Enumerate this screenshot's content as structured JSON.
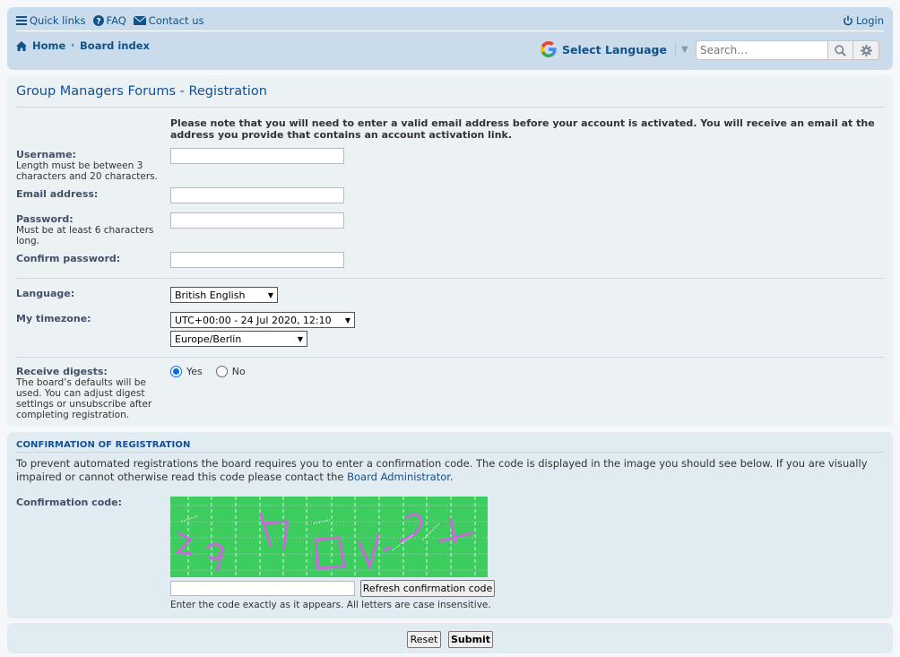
{
  "header": {
    "quick_links": "Quick links",
    "faq": "FAQ",
    "contact": "Contact us",
    "login": "Login",
    "breadcrumb_home": "Home",
    "breadcrumb_board": "Board index",
    "select_language": "Select Language",
    "search_placeholder": "Search…"
  },
  "registration": {
    "title": "Group Managers Forums - Registration",
    "notice": "Please note that you will need to enter a valid email address before your account is activated. You will receive an email at the address you provide that contains an account activation link.",
    "username_label": "Username:",
    "username_explain": "Length must be between 3 characters and 20 characters.",
    "email_label": "Email address:",
    "password_label": "Password:",
    "password_explain": "Must be at least 6 characters long.",
    "confirm_password_label": "Confirm password:",
    "language_label": "Language:",
    "language_value": "British English",
    "timezone_label": "My timezone:",
    "timezone_value": "UTC+00:00 - 24 Jul 2020, 12:10",
    "timezone_region": "Europe/Berlin",
    "digests_label": "Receive digests:",
    "digests_explain": "The board’s defaults will be used. You can adjust digest settings or unsubscribe after completing registration.",
    "digests_yes": "Yes",
    "digests_no": "No"
  },
  "confirmation": {
    "title": "CONFIRMATION OF REGISTRATION",
    "text": "To prevent automated registrations the board requires you to enter a confirmation code. The code is displayed in the image you should see below. If you are visually impaired or cannot otherwise read this code please contact the ",
    "admin_link": "Board Administrator",
    "text_end": ".",
    "code_label": "Confirmation code:",
    "refresh_button": "Refresh confirmation code",
    "code_explain": "Enter the code exactly as it appears. All letters are case insensitive."
  },
  "actions": {
    "reset": "Reset",
    "submit": "Submit"
  },
  "colors": {
    "header_bg": "#cadceb",
    "link": "#105289",
    "captcha_bg": "#3dcc5e"
  }
}
